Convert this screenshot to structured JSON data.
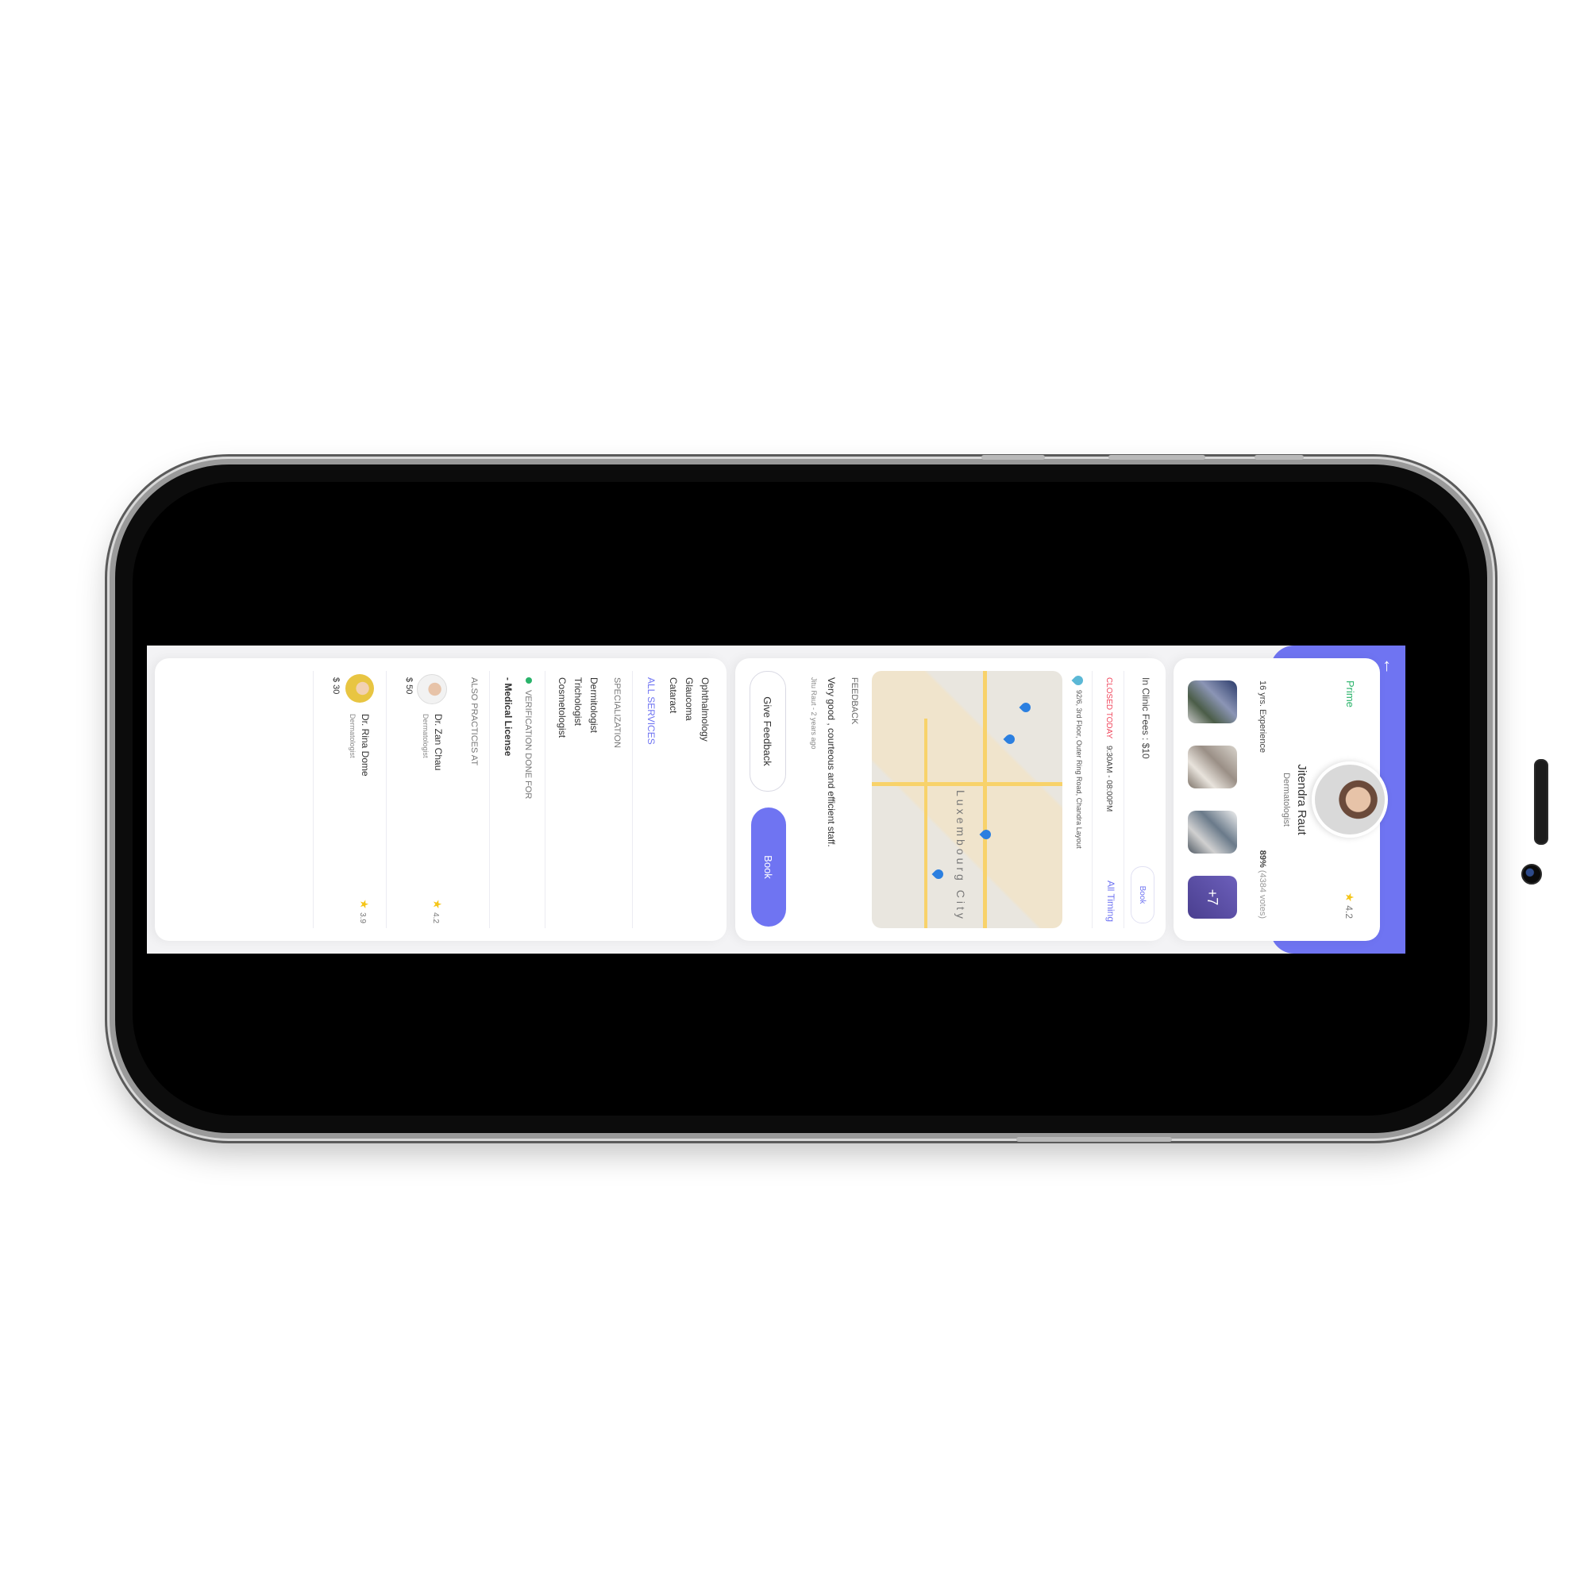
{
  "profile": {
    "badge": "Prime",
    "rating": "4.2",
    "name": "Jitendra Raut",
    "specialty": "Dermatologist",
    "experience": "16 yrs. Experience",
    "votes_pct": "89%",
    "votes_count": "(4384 votes)",
    "more_photos": "+7"
  },
  "clinic": {
    "fees": "In Clinic Fees : $10",
    "book_small": "Book",
    "status": "CLOSED TODAY",
    "hours": "9:30AM - 08:00PM",
    "all_timing": "All Timing",
    "address": "92/6, 3rd Floor, Outer Ring Road, Chandra Layout",
    "map_city": "Luxembourg City",
    "feedback_title": "FEEDBACK",
    "feedback_text": "Very good , courteous and efficient staff.",
    "feedback_author": "Jitu Raut - 2 years ago",
    "give_feedback": "Give Feedback",
    "book": "Book"
  },
  "info": {
    "services": [
      "Ophthalmology",
      "Glaucoma",
      "Cataract"
    ],
    "all_services": "ALL SERVICES",
    "specialization_title": "SPECIALIZATION",
    "specializations": [
      "Dermitologist",
      "Trichologist",
      "Cosmetologist"
    ],
    "verification_title": "VERIFICATION DONE FOR",
    "verification_item": "- Medical License",
    "practices_title": "ALSO PRACTICES AT",
    "practices": [
      {
        "name": "Dr. Zan Chau",
        "spec": "Dermatologist",
        "fee": "$ 50",
        "rating": "4.2"
      },
      {
        "name": "Dr. Rina Dome",
        "spec": "Dermatologist",
        "fee": "$ 30",
        "rating": "3.9"
      }
    ]
  },
  "colors": {
    "accent": "#6f74f2",
    "closed": "#f0465c",
    "prime": "#29b36a",
    "star": "#f5c518"
  }
}
